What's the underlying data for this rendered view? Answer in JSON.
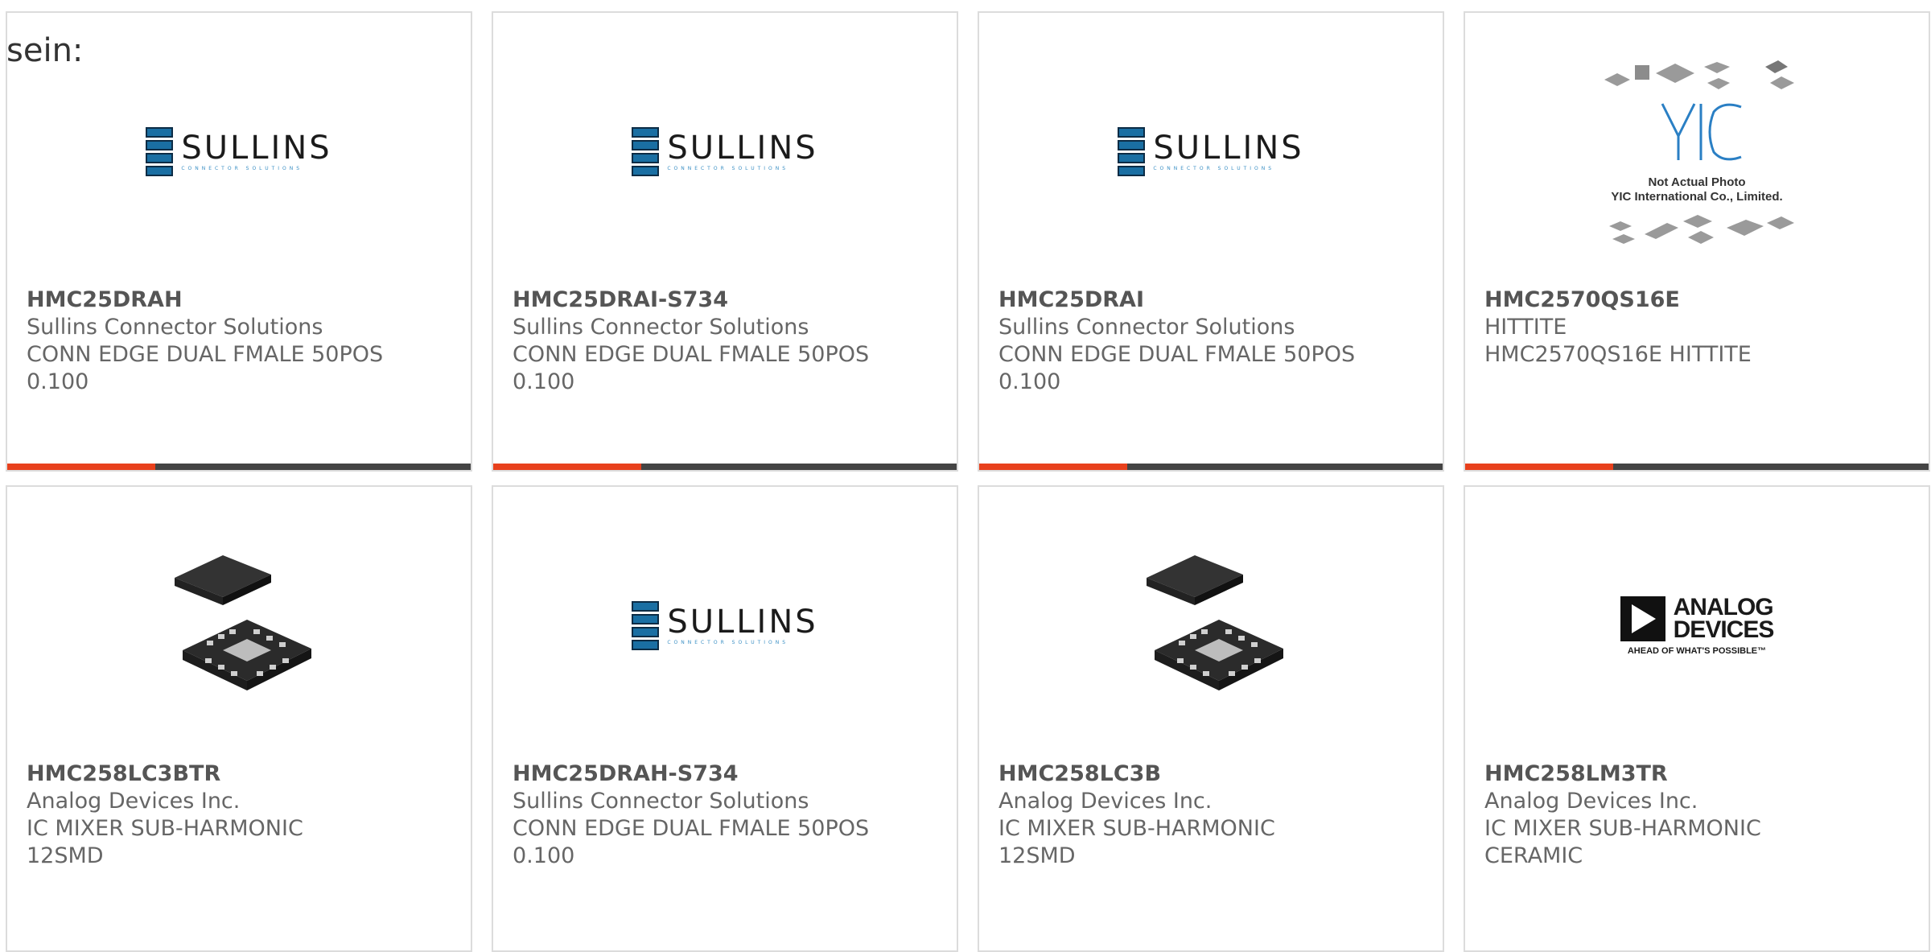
{
  "lead_text": "sein:",
  "logos": {
    "sullins_name": "SULLINS",
    "sullins_sub": "CONNECTOR SOLUTIONS",
    "adi_line1": "ANALOG",
    "adi_line2": "DEVICES",
    "adi_tag": "AHEAD OF WHAT'S POSSIBLE™",
    "yic_line1": "Not Actual Photo",
    "yic_line2": "YIC International Co., Limited."
  },
  "products": [
    {
      "part": "HMC25DRAH",
      "maker": "Sullins Connector Solutions",
      "desc1": "CONN EDGE DUAL FMALE 50POS",
      "desc2": "0.100"
    },
    {
      "part": "HMC25DRAI-S734",
      "maker": "Sullins Connector Solutions",
      "desc1": "CONN EDGE DUAL FMALE 50POS",
      "desc2": "0.100"
    },
    {
      "part": "HMC25DRAI",
      "maker": "Sullins Connector Solutions",
      "desc1": "CONN EDGE DUAL FMALE 50POS",
      "desc2": "0.100"
    },
    {
      "part": "HMC2570QS16E",
      "maker": "HITTITE",
      "desc1": "HMC2570QS16E HITTITE",
      "desc2": ""
    },
    {
      "part": "HMC258LC3BTR",
      "maker": "Analog Devices Inc.",
      "desc1": "IC MIXER SUB-HARMONIC",
      "desc2": "12SMD"
    },
    {
      "part": "HMC25DRAH-S734",
      "maker": "Sullins Connector Solutions",
      "desc1": "CONN EDGE DUAL FMALE 50POS",
      "desc2": "0.100"
    },
    {
      "part": "HMC258LC3B",
      "maker": "Analog Devices Inc.",
      "desc1": "IC MIXER SUB-HARMONIC",
      "desc2": "12SMD"
    },
    {
      "part": "HMC258LM3TR",
      "maker": "Analog Devices Inc.",
      "desc1": "IC MIXER SUB-HARMONIC",
      "desc2": "CERAMIC"
    }
  ],
  "progress_fraction": 0.32,
  "colors": {
    "accent": "#e8401c",
    "bar": "#444444",
    "brand_blue": "#1a6fa3"
  }
}
